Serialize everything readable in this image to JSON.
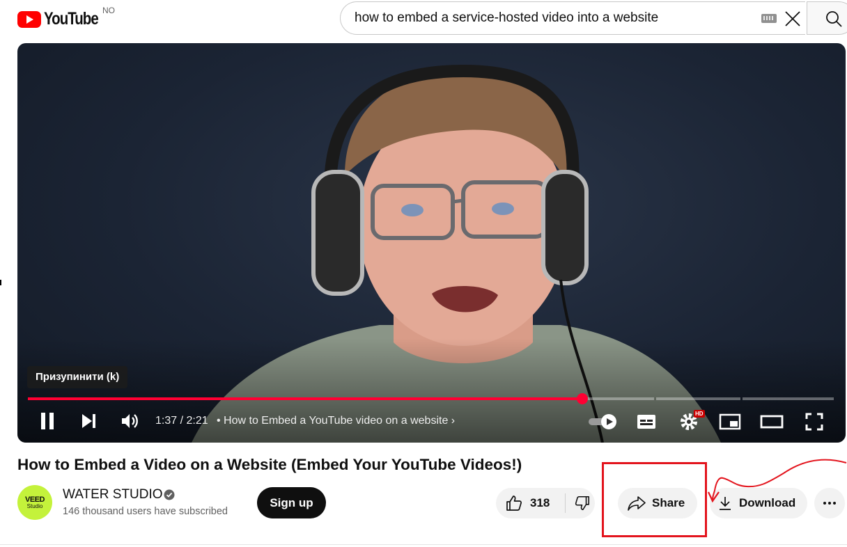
{
  "header": {
    "logo_text": "YouTube",
    "region_code": "NO",
    "search_value": "how to embed a service-hosted video into a website"
  },
  "player": {
    "tooltip": "Призупинити (k)",
    "current_time": "1:37",
    "duration": "2:21",
    "time_display": "1:37 / 2:21",
    "chapter_title": "How to Embed a YouTube video on a website",
    "progress_fraction": 0.688,
    "hd_badge": "HD",
    "accent_color": "#ff0033"
  },
  "video": {
    "title": "How to Embed a Video on a Website (Embed Your YouTube Videos!)"
  },
  "channel": {
    "avatar_line1": "VEED",
    "avatar_line2": "Studio",
    "name": "WATER STUDIO",
    "subscribers": "146 thousand users have subscribed",
    "subscribe_label": "Sign up"
  },
  "actions": {
    "like_count": "318",
    "share_label": "Share",
    "download_label": "Download"
  },
  "annotation": {
    "color": "#e3141d"
  }
}
